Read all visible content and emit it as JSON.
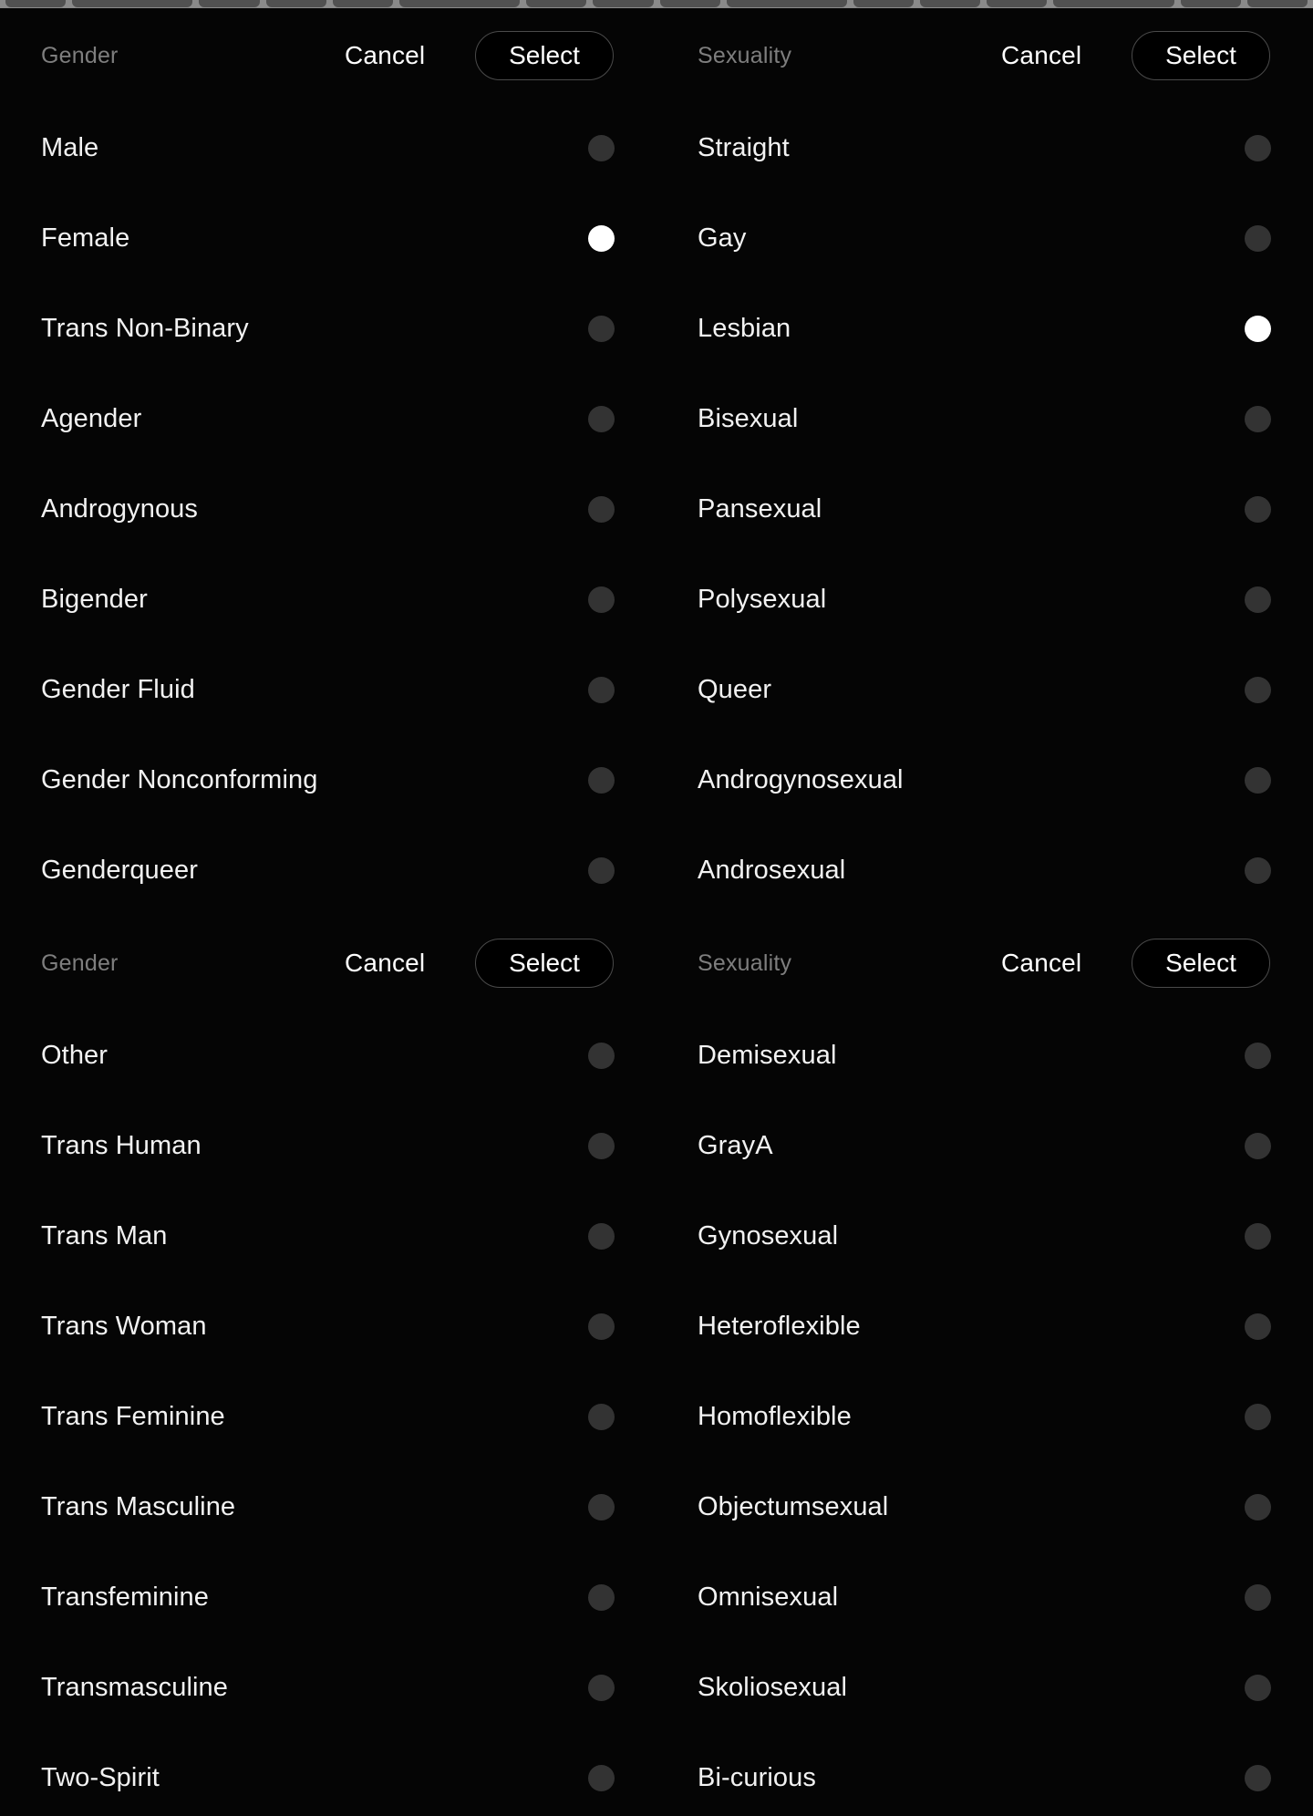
{
  "screen": {
    "background": "#000000",
    "selected_radio_color": "#ffffff",
    "unselected_radio_color": "#333333",
    "label_color": "#7e7e7e",
    "text_color": "#f2f2f2"
  },
  "header_bars": [
    {
      "gender": {
        "label": "Gender",
        "cancel": "Cancel",
        "select": "Select"
      },
      "sexuality": {
        "label": "Sexuality",
        "cancel": "Cancel",
        "select": "Select"
      }
    },
    {
      "gender": {
        "label": "Gender",
        "cancel": "Cancel",
        "select": "Select"
      },
      "sexuality": {
        "label": "Sexuality",
        "cancel": "Cancel",
        "select": "Select"
      }
    }
  ],
  "section_one": {
    "gender_options": [
      {
        "label": "Male",
        "selected": false
      },
      {
        "label": "Female",
        "selected": true
      },
      {
        "label": "Trans Non-Binary",
        "selected": false
      },
      {
        "label": "Agender",
        "selected": false
      },
      {
        "label": "Androgynous",
        "selected": false
      },
      {
        "label": "Bigender",
        "selected": false
      },
      {
        "label": "Gender Fluid",
        "selected": false
      },
      {
        "label": "Gender Nonconforming",
        "selected": false
      },
      {
        "label": "Genderqueer",
        "selected": false
      }
    ],
    "sexuality_options": [
      {
        "label": "Straight",
        "selected": false
      },
      {
        "label": "Gay",
        "selected": false
      },
      {
        "label": "Lesbian",
        "selected": true
      },
      {
        "label": "Bisexual",
        "selected": false
      },
      {
        "label": "Pansexual",
        "selected": false
      },
      {
        "label": "Polysexual",
        "selected": false
      },
      {
        "label": "Queer",
        "selected": false
      },
      {
        "label": "Androgynosexual",
        "selected": false
      },
      {
        "label": "Androsexual",
        "selected": false
      }
    ]
  },
  "section_two": {
    "gender_options": [
      {
        "label": "Other",
        "selected": false
      },
      {
        "label": "Trans Human",
        "selected": false
      },
      {
        "label": "Trans Man",
        "selected": false
      },
      {
        "label": "Trans Woman",
        "selected": false
      },
      {
        "label": "Trans Feminine",
        "selected": false
      },
      {
        "label": "Trans Masculine",
        "selected": false
      },
      {
        "label": "Transfeminine",
        "selected": false
      },
      {
        "label": "Transmasculine",
        "selected": false
      },
      {
        "label": "Two-Spirit",
        "selected": false
      }
    ],
    "sexuality_options": [
      {
        "label": "Demisexual",
        "selected": false
      },
      {
        "label": "GrayA",
        "selected": false
      },
      {
        "label": "Gynosexual",
        "selected": false
      },
      {
        "label": "Heteroflexible",
        "selected": false
      },
      {
        "label": "Homoflexible",
        "selected": false
      },
      {
        "label": "Objectumsexual",
        "selected": false
      },
      {
        "label": "Omnisexual",
        "selected": false
      },
      {
        "label": "Skoliosexual",
        "selected": false
      },
      {
        "label": "Bi-curious",
        "selected": false
      }
    ]
  }
}
